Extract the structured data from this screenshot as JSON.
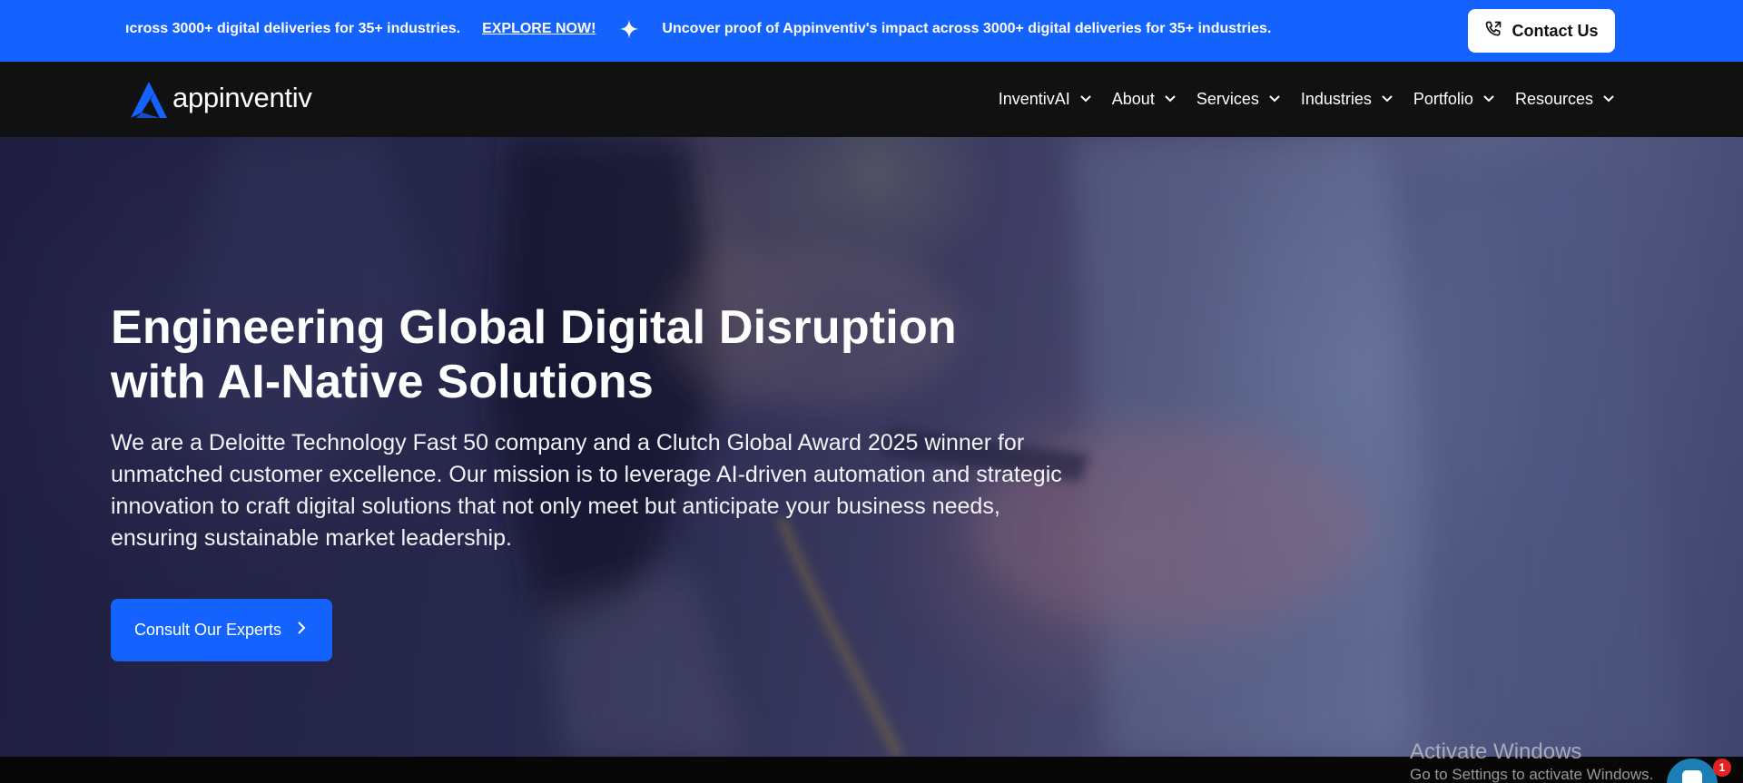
{
  "announcement": {
    "message_start": "ıcross 3000+ digital deliveries for 35+ industries.",
    "link_label": "EXPLORE NOW!",
    "message": "Uncover proof of Appinventiv's impact across 3000+ digital deliveries for 35+ industries.",
    "contact_label": "Contact Us",
    "colors": {
      "bar": "#1463ff",
      "button_bg": "#ffffff"
    }
  },
  "nav": {
    "logo_text": "appinventiv",
    "items": [
      {
        "label": "InventivAI"
      },
      {
        "label": "About"
      },
      {
        "label": "Services"
      },
      {
        "label": "Industries"
      },
      {
        "label": "Portfolio"
      },
      {
        "label": "Resources"
      }
    ],
    "colors": {
      "background": "#111111",
      "text": "#ffffff"
    }
  },
  "hero": {
    "title_line1": "Engineering Global Digital Disruption",
    "title_line2": "with AI-Native Solutions",
    "description": "We are a Deloitte Technology Fast 50 company and a Clutch Global Award 2025 winner for unmatched customer excellence. Our mission is to leverage AI-driven automation and strategic innovation to craft digital solutions that not only meet but anticipate your business needs, ensuring sustainable market leadership.",
    "cta_label": "Consult Our Experts",
    "colors": {
      "cta": "#1463ff"
    }
  },
  "watermark": {
    "line1": "Activate Windows",
    "line2": "Go to Settings to activate Windows."
  },
  "chat": {
    "badge_count": "1"
  }
}
